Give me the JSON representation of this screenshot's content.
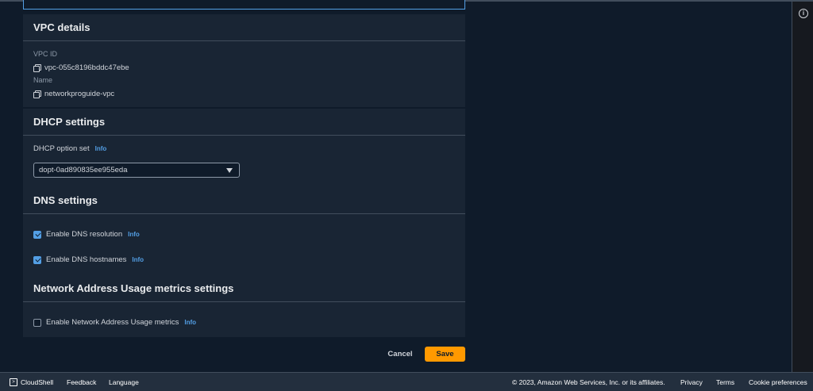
{
  "vpc_details": {
    "title": "VPC details",
    "vpc_id_label": "VPC ID",
    "vpc_id_value": "vpc-055c8196bddc47ebe",
    "name_label": "Name",
    "name_value": "networkproguide-vpc"
  },
  "dhcp_settings": {
    "title": "DHCP settings",
    "option_set_label": "DHCP option set",
    "info": "Info",
    "selected_option": "dopt-0ad890835ee955eda"
  },
  "dns_settings": {
    "title": "DNS settings",
    "resolution_label": "Enable DNS resolution",
    "resolution_checked": true,
    "hostnames_label": "Enable DNS hostnames",
    "hostnames_checked": true,
    "info": "Info"
  },
  "nau_settings": {
    "title": "Network Address Usage metrics settings",
    "metrics_label": "Enable Network Address Usage metrics",
    "metrics_checked": false,
    "info": "Info"
  },
  "actions": {
    "cancel": "Cancel",
    "save": "Save"
  },
  "footer": {
    "cloudshell": "CloudShell",
    "feedback": "Feedback",
    "language": "Language",
    "copyright": "© 2023, Amazon Web Services, Inc. or its affiliates.",
    "privacy": "Privacy",
    "terms": "Terms",
    "cookie_preferences": "Cookie preferences"
  },
  "colors": {
    "accent": "#539fe5",
    "save_button": "#ff9900",
    "background": "#0f1b2a",
    "container": "#192534"
  },
  "icons": {
    "panel_info": "info-circle-icon",
    "copy": "copy-icon",
    "dropdown": "caret-down-icon",
    "cloudshell": "terminal-icon"
  }
}
